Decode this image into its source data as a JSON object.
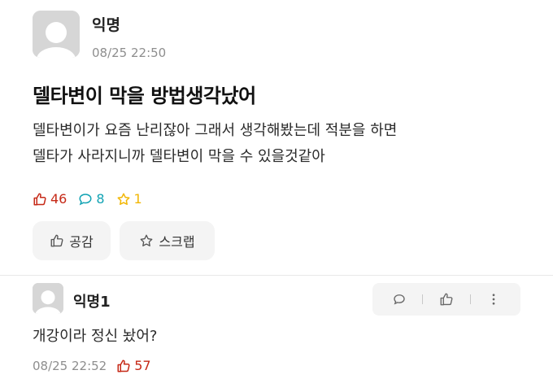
{
  "post": {
    "author": "익명",
    "time": "08/25 22:50",
    "title": "델타변이 막을 방법생각났어",
    "body_lines": [
      "델타변이가 요즘 난리잖아 그래서 생각해봤는데 적분을 하면",
      "델타가 사라지니까 델타변이 막을 수 있을것같아"
    ],
    "stats": {
      "likes": "46",
      "comments": "8",
      "scraps": "1"
    },
    "buttons": {
      "like_label": "공감",
      "scrap_label": "스크랩"
    }
  },
  "comment": {
    "author": "익명1",
    "text": "개강이라 정신 놨어?",
    "time": "08/25 22:52",
    "likes": "57"
  },
  "colors": {
    "like_red": "#c62917",
    "comment_teal": "#12a3b4",
    "scrap_yellow": "#f2b705",
    "meta_gray": "#8e8e8e"
  },
  "icons": [
    "avatar-icon",
    "thumbs-up-icon",
    "speech-bubble-icon",
    "star-icon",
    "more-vertical-icon"
  ]
}
